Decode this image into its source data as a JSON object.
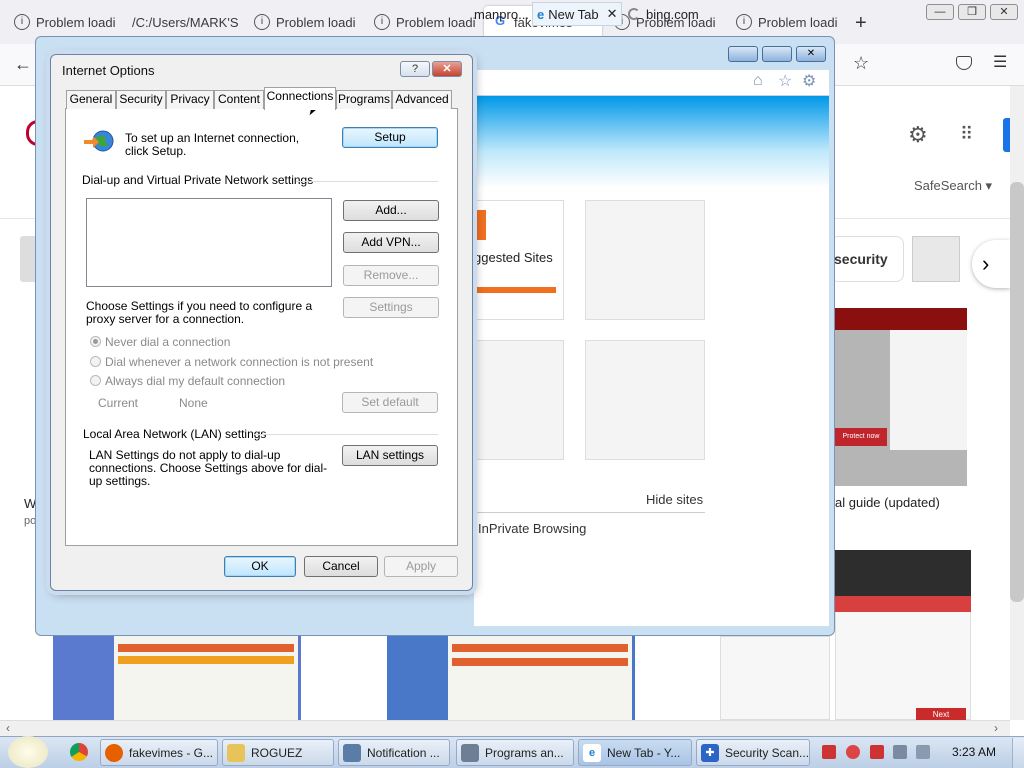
{
  "firefox": {
    "tabs": [
      {
        "label": "Problem loadi",
        "active": false
      },
      {
        "label": "/C:/Users/MARK'S",
        "active": false
      },
      {
        "label": "Problem loadi",
        "active": false
      },
      {
        "label": "Problem loadi",
        "active": false
      },
      {
        "label": "fakevimes -",
        "active": true
      },
      {
        "label": "Problem loadi",
        "active": false
      },
      {
        "label": "Problem loadi",
        "active": false
      }
    ],
    "new_tab": "+",
    "tab_close": "×"
  },
  "background_page": {
    "safesearch": "SafeSearch ▾",
    "security_chip": "security",
    "guide_text": "al guide (updated)",
    "left_w": "W",
    "left_po": "po",
    "protect_now": "Protect now",
    "next_btn": "Next"
  },
  "ie": {
    "tabs": [
      {
        "label": "manpro..."
      },
      {
        "label": "New Tab"
      },
      {
        "label": "bing.com"
      }
    ],
    "suggested_sites": "ggested Sites",
    "hide_sites": "Hide sites",
    "inprivate": "InPrivate Browsing"
  },
  "dialog": {
    "title": "Internet Options",
    "help": "?",
    "tabs": [
      "General",
      "Security",
      "Privacy",
      "Content",
      "Connections",
      "Programs",
      "Advanced"
    ],
    "active_tab": "Connections",
    "setup_text": "To set up an Internet connection, click Setup.",
    "setup_button": "Setup",
    "dialup_heading": "Dial-up and Virtual Private Network settings",
    "add_button": "Add...",
    "add_vpn_button": "Add VPN...",
    "remove_button": "Remove...",
    "settings_text": "Choose Settings if you need to configure a proxy server for a connection.",
    "settings_button": "Settings",
    "radio_never": "Never dial a connection",
    "radio_whenever": "Dial whenever a network connection is not present",
    "radio_always": "Always dial my default connection",
    "current_label": "Current",
    "current_value": "None",
    "set_default_button": "Set default",
    "lan_heading": "Local Area Network (LAN) settings",
    "lan_text": "LAN Settings do not apply to dial-up connections. Choose Settings above for dial-up settings.",
    "lan_button": "LAN settings",
    "ok": "OK",
    "cancel": "Cancel",
    "apply": "Apply"
  },
  "taskbar": {
    "items": [
      {
        "label": "fakevimes - G..."
      },
      {
        "label": "ROGUEZ"
      },
      {
        "label": "Notification ..."
      },
      {
        "label": "Programs an..."
      },
      {
        "label": "New Tab - Y..."
      },
      {
        "label": "Security Scan..."
      }
    ],
    "clock": "3:23 AM"
  }
}
